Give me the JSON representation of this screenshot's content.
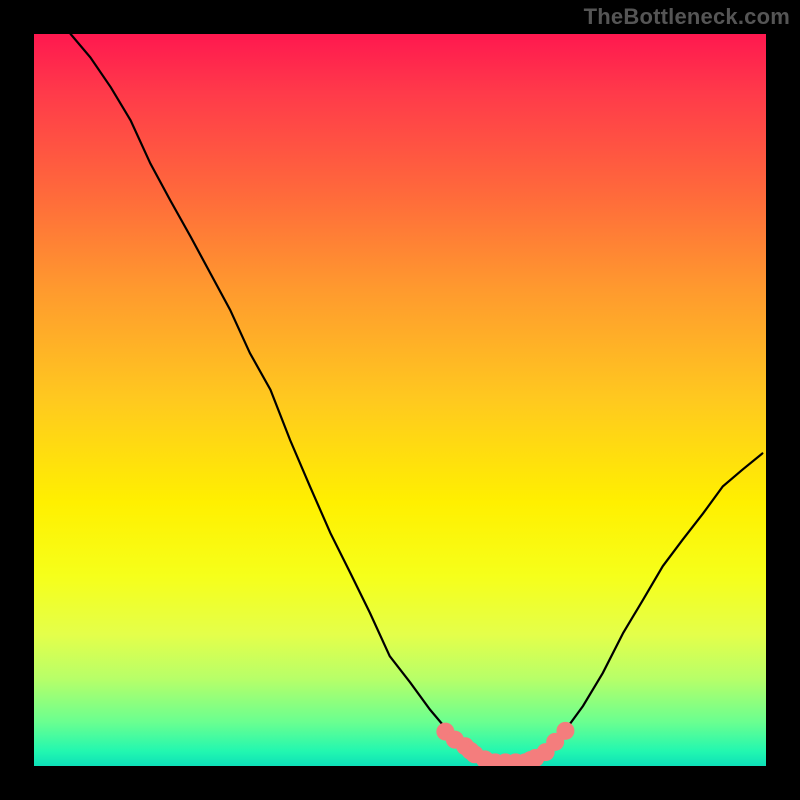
{
  "watermark": "TheBottleneck.com",
  "chart_data": {
    "type": "line",
    "title": "",
    "xlabel": "",
    "ylabel": "",
    "xlim": [
      0,
      100
    ],
    "ylim": [
      0,
      100
    ],
    "grid": false,
    "legend": false,
    "series": [
      {
        "name": "bottleneck-curve",
        "x": [
          5,
          7.7,
          10.5,
          13.2,
          15.9,
          18.6,
          21.4,
          24.1,
          26.8,
          29.5,
          32.3,
          35,
          37.7,
          40.5,
          43.2,
          45.9,
          48.6,
          51.4,
          54.1,
          56.8,
          57.5,
          58.2,
          59.5,
          60.5,
          62.3,
          63.7,
          65,
          66.4,
          67.7,
          68.6,
          70,
          72.3,
          75,
          77.7,
          80.5,
          83.2,
          85.9,
          88.6,
          91.4,
          94.1,
          96.8,
          99.5
        ],
        "y": [
          100,
          96.8,
          92.7,
          88.2,
          82.3,
          77.3,
          72.3,
          67.3,
          62.3,
          56.4,
          51.4,
          44.5,
          38.2,
          31.8,
          26.4,
          20.9,
          15,
          11.4,
          7.7,
          4.5,
          3.6,
          2.7,
          1.8,
          0.9,
          0.5,
          0.5,
          0.5,
          0.5,
          0.5,
          0.9,
          1.8,
          4.5,
          8.2,
          12.7,
          18.2,
          22.7,
          27.3,
          30.9,
          34.5,
          38.2,
          40.5,
          42.7
        ]
      }
    ],
    "markers": {
      "name": "highlight-dots",
      "color": "#f47d7d",
      "radius_px": 9,
      "x": [
        56.2,
        57.5,
        58.9,
        59.6,
        60.2,
        61.6,
        63.0,
        64.4,
        65.8,
        67.1,
        67.8,
        68.5,
        69.9,
        71.2,
        72.6
      ],
      "y": [
        4.7,
        3.6,
        2.7,
        2.1,
        1.6,
        0.9,
        0.5,
        0.5,
        0.5,
        0.5,
        0.8,
        1.1,
        1.9,
        3.3,
        4.8
      ]
    },
    "gradient_stops": [
      {
        "pos": 0.0,
        "color": "#ff184f"
      },
      {
        "pos": 0.08,
        "color": "#ff3a4a"
      },
      {
        "pos": 0.22,
        "color": "#ff6a3b"
      },
      {
        "pos": 0.35,
        "color": "#ff9a2e"
      },
      {
        "pos": 0.5,
        "color": "#ffc91f"
      },
      {
        "pos": 0.64,
        "color": "#fff000"
      },
      {
        "pos": 0.74,
        "color": "#f6ff1a"
      },
      {
        "pos": 0.82,
        "color": "#e4ff4a"
      },
      {
        "pos": 0.88,
        "color": "#b8ff68"
      },
      {
        "pos": 0.94,
        "color": "#6aff90"
      },
      {
        "pos": 0.98,
        "color": "#22f7b0"
      },
      {
        "pos": 1.0,
        "color": "#0de0b8"
      }
    ]
  }
}
